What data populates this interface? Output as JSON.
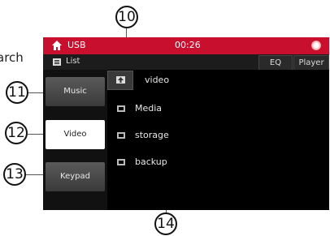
{
  "partial_text": "arch",
  "callouts": {
    "c10": "10",
    "c11": "11",
    "c12": "12",
    "c13": "13",
    "c14": "14"
  },
  "topbar": {
    "home_icon": "home-icon",
    "source_label": "USB",
    "time": "00:26",
    "settings_icon": "sun-settings-icon"
  },
  "subbar": {
    "list_icon": "list-icon",
    "list_label": "List",
    "eq_label": "EQ",
    "player_label": "Player"
  },
  "sidebar": {
    "music": "Music",
    "video": "Video",
    "keypad": "Keypad"
  },
  "browser": {
    "current_folder": "video",
    "up_icon": "folder-up-icon",
    "items": [
      {
        "label": "Media",
        "icon": "folder-icon"
      },
      {
        "label": "storage",
        "icon": "folder-icon"
      },
      {
        "label": "backup",
        "icon": "folder-icon"
      }
    ]
  },
  "colors": {
    "topbar": "#c8102e",
    "screen_bg": "#000000",
    "active_button": "#ffffff"
  }
}
